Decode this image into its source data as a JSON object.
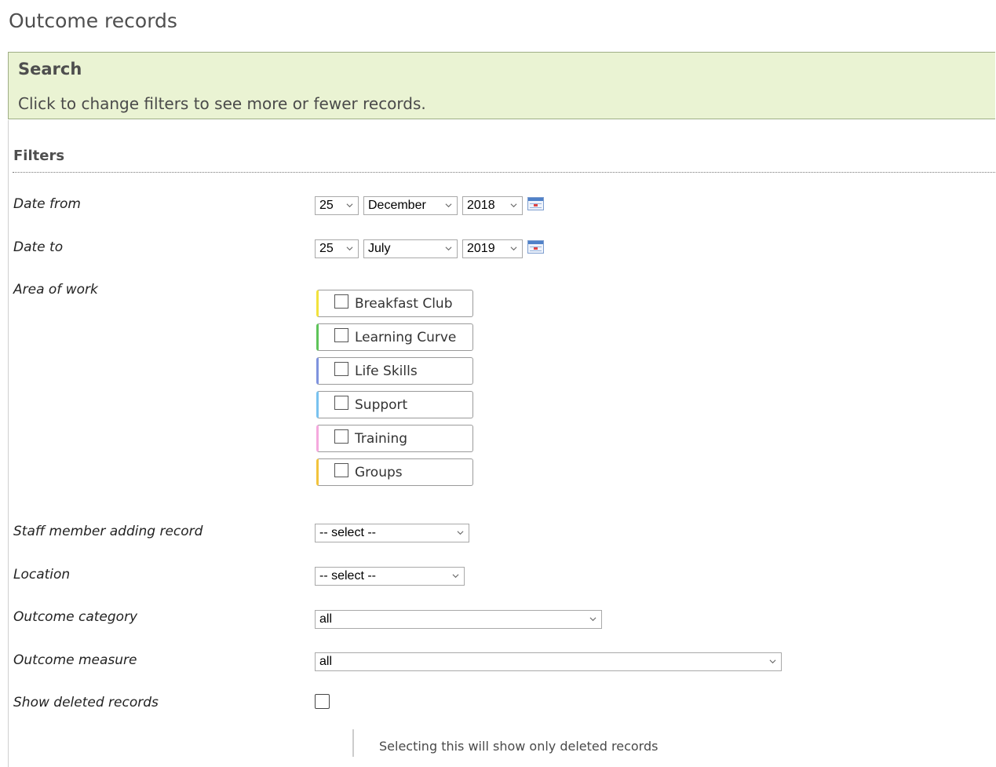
{
  "page": {
    "title": "Outcome records"
  },
  "search": {
    "title": "Search",
    "description": "Click to change filters to see more or fewer records."
  },
  "filters": {
    "title": "Filters",
    "date_from": {
      "label": "Date from",
      "day": "25",
      "month": "December",
      "year": "2018"
    },
    "date_to": {
      "label": "Date to",
      "day": "25",
      "month": "July",
      "year": "2019"
    },
    "area_of_work": {
      "label": "Area of work",
      "items": [
        {
          "label": "Breakfast Club",
          "color": "#f2e23c",
          "checked": false
        },
        {
          "label": "Learning Curve",
          "color": "#5ec45a",
          "checked": false
        },
        {
          "label": "Life Skills",
          "color": "#7f93de",
          "checked": false
        },
        {
          "label": "Support",
          "color": "#79c2ef",
          "checked": false
        },
        {
          "label": "Training",
          "color": "#f5a9de",
          "checked": false
        },
        {
          "label": "Groups",
          "color": "#f2c33c",
          "checked": false
        }
      ]
    },
    "staff_member": {
      "label": "Staff member adding record",
      "value": "-- select --"
    },
    "location": {
      "label": "Location",
      "value": "-- select --"
    },
    "outcome_category": {
      "label": "Outcome category",
      "value": "all"
    },
    "outcome_measure": {
      "label": "Outcome measure",
      "value": "all"
    },
    "show_deleted": {
      "label": "Show deleted records",
      "checked": false,
      "help": "Selecting this will show only deleted records"
    }
  },
  "icons": {
    "calendar": "calendar-icon",
    "dropdown": "chevron-down-icon",
    "checkbox": "checkbox-icon"
  }
}
